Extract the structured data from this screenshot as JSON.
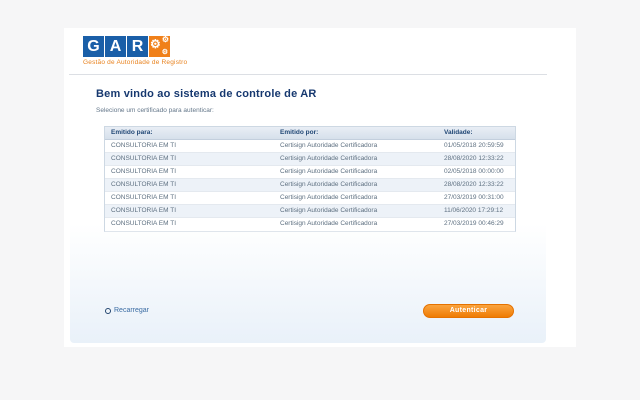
{
  "logo": {
    "letters": [
      "G",
      "A",
      "R"
    ],
    "tagline": "Gestão de Autoridade de Registro",
    "blue": "#1a5fa8",
    "orange": "#f08019"
  },
  "main": {
    "title": "Bem vindo ao sistema de controle de AR",
    "subtitle": "Selecione um certificado para autenticar:"
  },
  "table": {
    "columns": [
      "Emitido para:",
      "Emitido por:",
      "Validade:"
    ],
    "rows": [
      [
        "CONSULTORIA EM TI",
        "Certisign Autoridade Certificadora",
        "01/05/2018 20:59:59"
      ],
      [
        "CONSULTORIA EM TI",
        "Certisign Autoridade Certificadora",
        "28/08/2020 12:33:22"
      ],
      [
        "CONSULTORIA EM TI",
        "Certisign Autoridade Certificadora",
        "02/05/2018 00:00:00"
      ],
      [
        "CONSULTORIA EM TI",
        "Certisign Autoridade Certificadora",
        "28/08/2020 12:33:22"
      ],
      [
        "CONSULTORIA EM TI",
        "Certisign Autoridade Certificadora",
        "27/03/2019 00:31:00"
      ],
      [
        "CONSULTORIA EM TI",
        "Certisign Autoridade Certificadora",
        "11/06/2020 17:29:12"
      ],
      [
        "CONSULTORIA EM TI",
        "Certisign Autoridade Certificadora",
        "27/03/2019 00:46:29"
      ]
    ]
  },
  "footer": {
    "reload_label": "Recarregar",
    "authenticate_label": "Autenticar",
    "button_orange": "#ef7c04",
    "link_blue": "#3a6ca3"
  }
}
